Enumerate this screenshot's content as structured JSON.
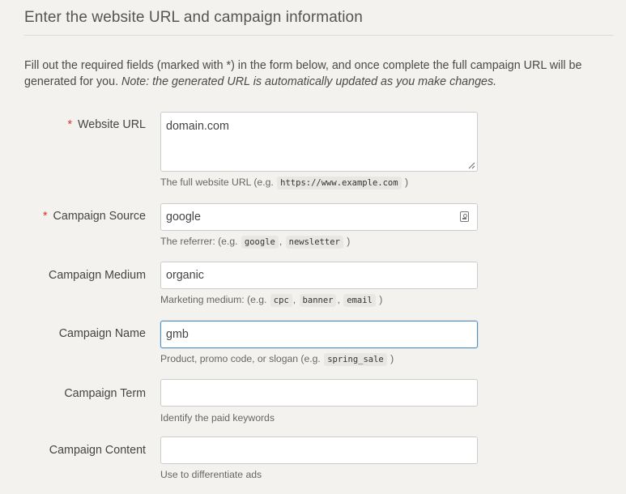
{
  "section": {
    "title": "Enter the website URL and campaign information",
    "intro_text": "Fill out the required fields (marked with *) in the form below, and once complete the full campaign URL will be generated for you.",
    "intro_note": "Note: the generated URL is automatically updated as you make changes."
  },
  "fields": {
    "website_url": {
      "label": "Website URL",
      "required_marker": "*",
      "value": "domain.com",
      "help_prefix": "The full website URL (e.g.",
      "help_examples": [
        "https://www.example.com"
      ],
      "help_suffix": ")"
    },
    "campaign_source": {
      "label": "Campaign Source",
      "required_marker": "*",
      "value": "google",
      "help_prefix": "The referrer: (e.g.",
      "help_examples": [
        "google",
        "newsletter"
      ],
      "help_suffix": ")"
    },
    "campaign_medium": {
      "label": "Campaign Medium",
      "value": "organic",
      "help_prefix": "Marketing medium: (e.g.",
      "help_examples": [
        "cpc",
        "banner",
        "email"
      ],
      "help_suffix": ")"
    },
    "campaign_name": {
      "label": "Campaign Name",
      "value": "gmb",
      "help_prefix": "Product, promo code, or slogan (e.g.",
      "help_examples": [
        "spring_sale"
      ],
      "help_suffix": ")"
    },
    "campaign_term": {
      "label": "Campaign Term",
      "value": "",
      "help": "Identify the paid keywords"
    },
    "campaign_content": {
      "label": "Campaign Content",
      "value": "",
      "help": "Use to differentiate ads"
    }
  },
  "colors": {
    "background": "#f3f2ef",
    "required": "#d9342b",
    "focus_border": "#4d90c4"
  }
}
